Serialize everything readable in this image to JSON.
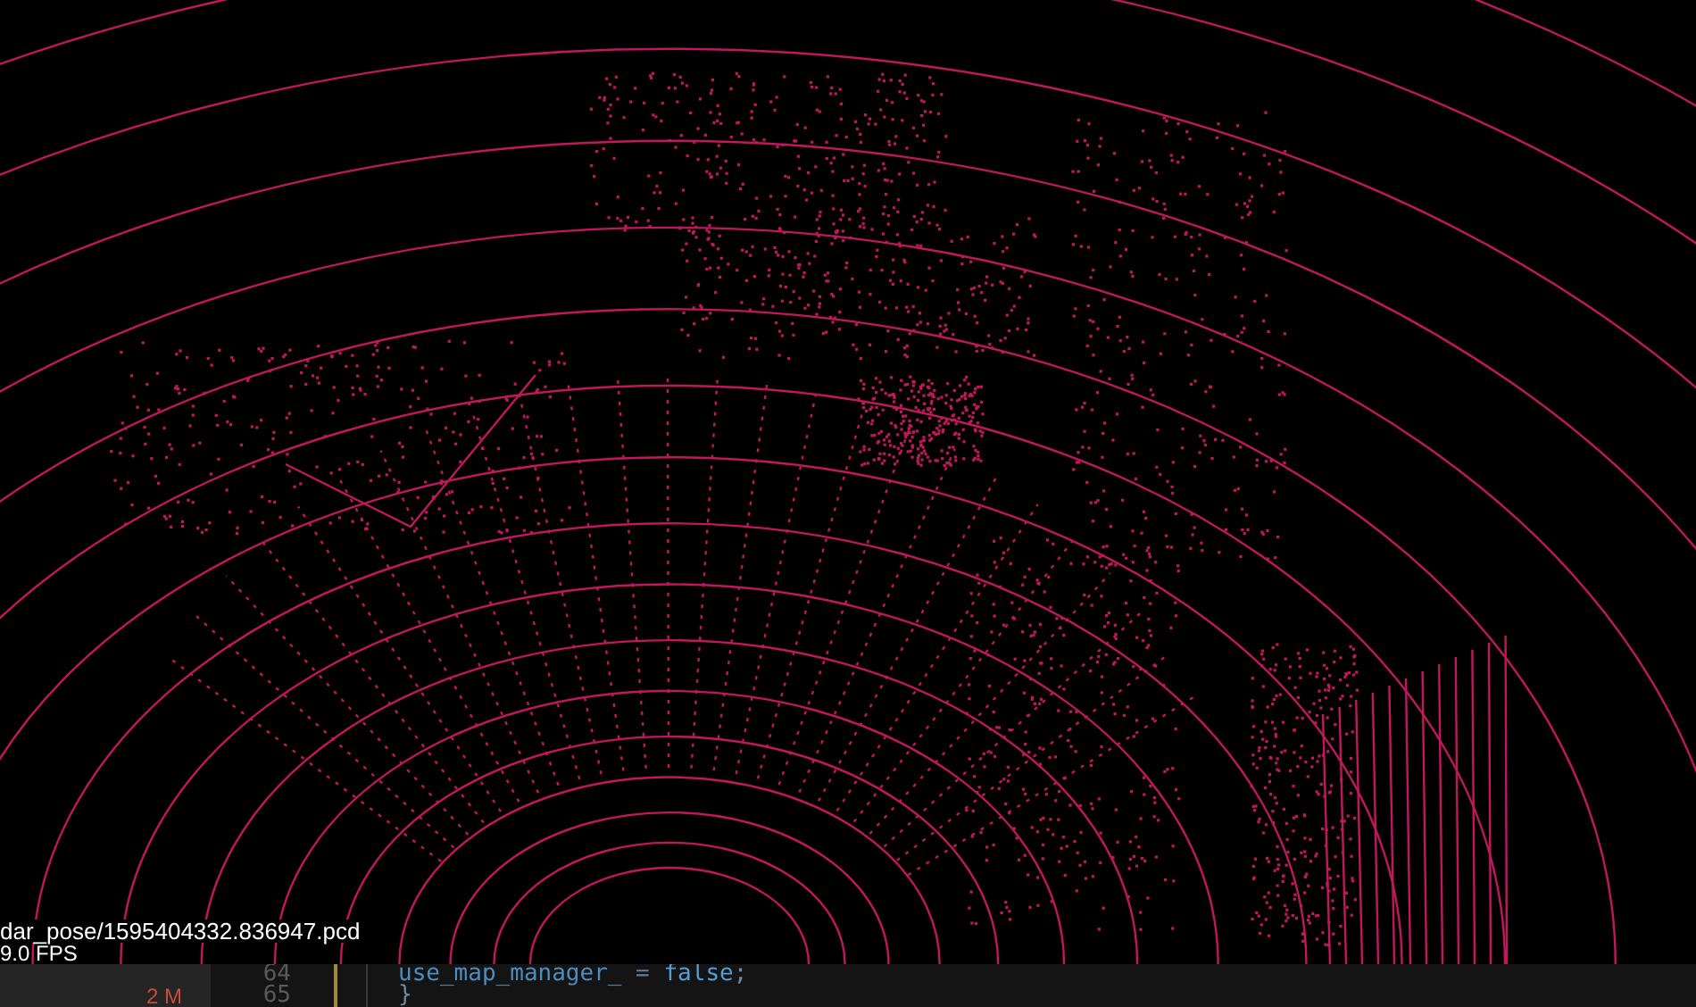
{
  "viewer": {
    "file_path": "dar_pose/1595404332.836947.pcd",
    "fps": "9.0 FPS"
  },
  "sidebar": {
    "badge": "2 M"
  },
  "editor": {
    "lines": [
      {
        "number": "64",
        "modified": true,
        "tokens": [
          {
            "kind": "identifier",
            "text": "use_map_manager_"
          },
          {
            "kind": "operator",
            "text": " = "
          },
          {
            "kind": "keyword",
            "text": "false"
          },
          {
            "kind": "punctuation",
            "text": ";"
          }
        ]
      },
      {
        "number": "65",
        "modified": true,
        "tokens": [
          {
            "kind": "punctuation",
            "text": "}"
          }
        ]
      }
    ]
  }
}
